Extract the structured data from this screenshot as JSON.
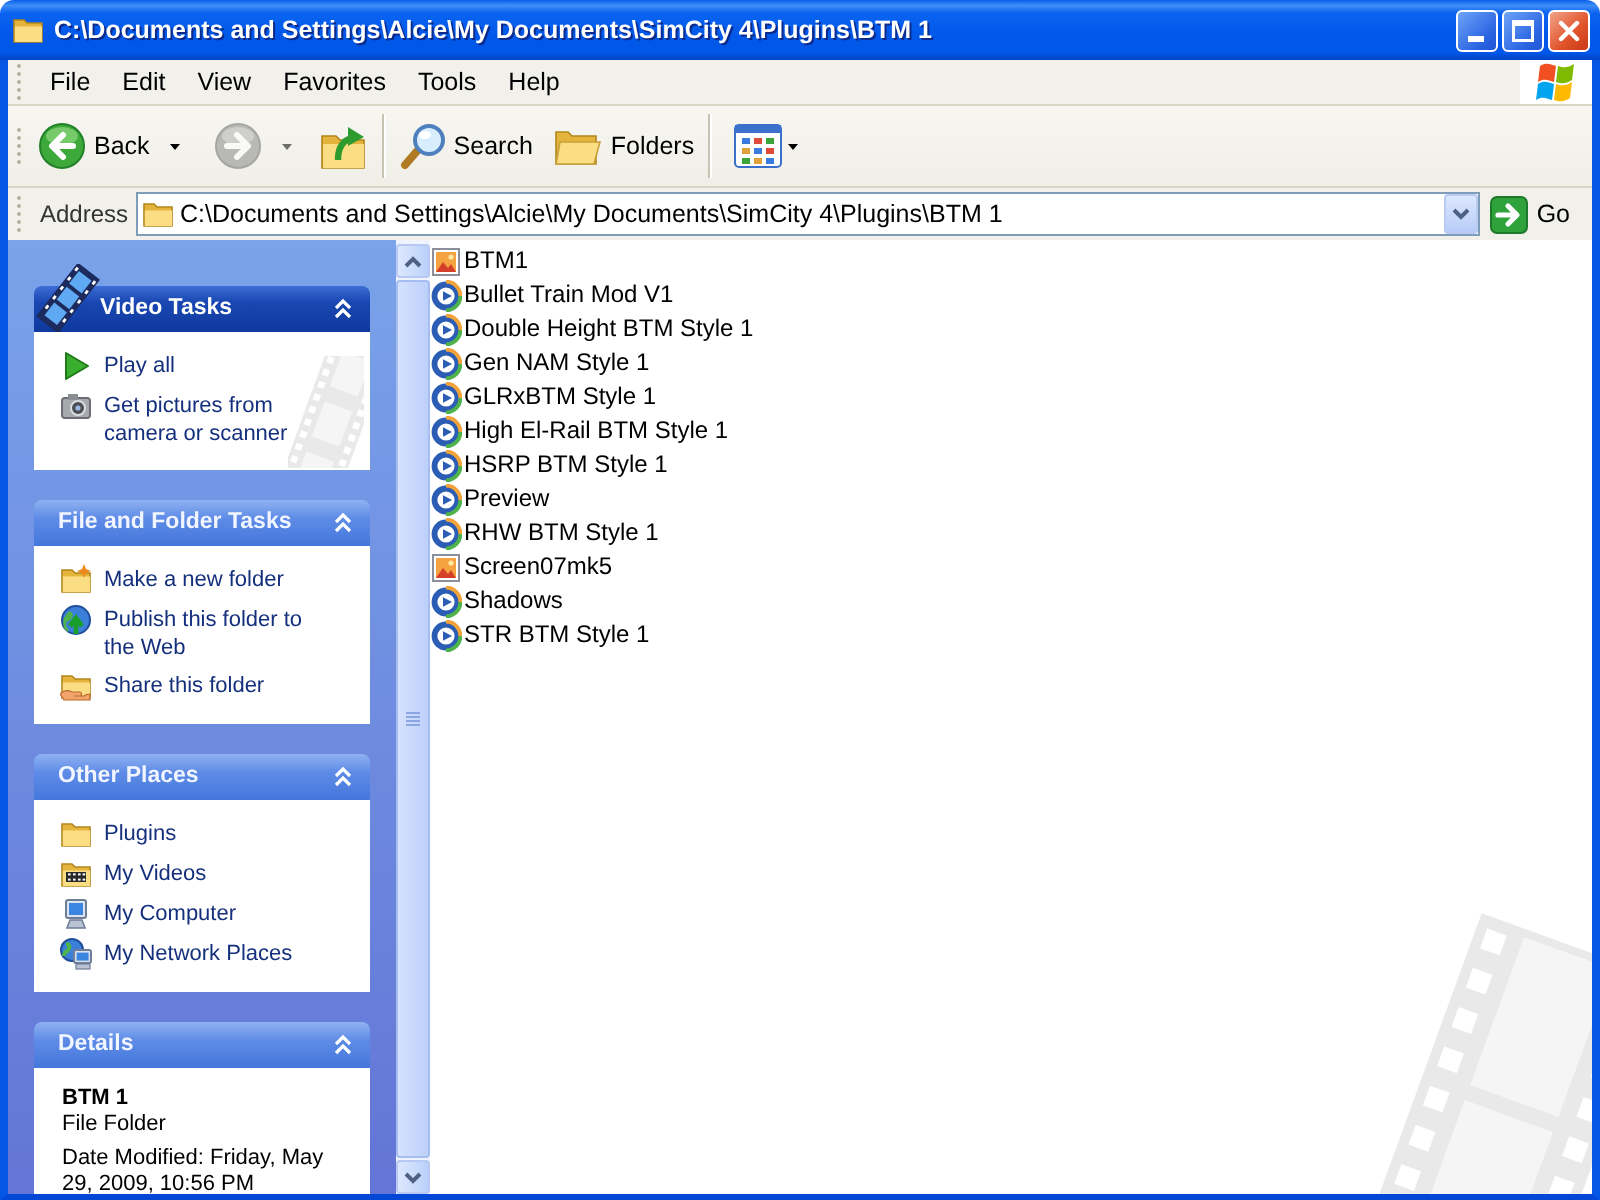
{
  "window": {
    "title": "C:\\Documents and Settings\\Alcie\\My Documents\\SimCity 4\\Plugins\\BTM 1"
  },
  "menu": [
    {
      "label": "File"
    },
    {
      "label": "Edit"
    },
    {
      "label": "View"
    },
    {
      "label": "Favorites"
    },
    {
      "label": "Tools"
    },
    {
      "label": "Help"
    }
  ],
  "toolbar": [
    {
      "kind": "back",
      "label": "Back",
      "disabled": false,
      "dropdown": true
    },
    {
      "kind": "forward",
      "disabled": true,
      "dropdown": true
    },
    {
      "kind": "up",
      "disabled": false,
      "dropdown": false
    },
    {
      "kind": "separator"
    },
    {
      "kind": "search",
      "label": "Search",
      "disabled": false,
      "dropdown": false
    },
    {
      "kind": "folders",
      "label": "Folders",
      "disabled": false,
      "dropdown": false
    },
    {
      "kind": "separator"
    },
    {
      "kind": "views",
      "disabled": false,
      "dropdown": true
    }
  ],
  "address_bar": {
    "label": "Address",
    "value": "C:\\Documents and Settings\\Alcie\\My Documents\\SimCity 4\\Plugins\\BTM 1",
    "go_label": "Go"
  },
  "task_panes": [
    {
      "kind": "special",
      "title": "Video Tasks",
      "expanded": true,
      "items": [
        {
          "kind": "play-all",
          "label": "Play all"
        },
        {
          "kind": "get-pictures",
          "label": "Get pictures from camera or scanner"
        }
      ]
    },
    {
      "kind": "normal",
      "title": "File and Folder Tasks",
      "expanded": true,
      "items": [
        {
          "kind": "new-folder",
          "label": "Make a new folder"
        },
        {
          "kind": "publish",
          "label": "Publish this folder to the Web"
        },
        {
          "kind": "share",
          "label": "Share this folder"
        }
      ]
    },
    {
      "kind": "normal",
      "title": "Other Places",
      "expanded": true,
      "items": [
        {
          "kind": "folder",
          "label": "Plugins"
        },
        {
          "kind": "videos",
          "label": "My Videos"
        },
        {
          "kind": "computer",
          "label": "My Computer"
        },
        {
          "kind": "network",
          "label": "My Network Places"
        }
      ]
    },
    {
      "kind": "details",
      "title": "Details",
      "expanded": true,
      "name": "BTM 1",
      "type": "File Folder",
      "modified": "Date Modified: Friday, May 29, 2009, 10:56 PM"
    }
  ],
  "files": [
    {
      "kind": "image",
      "name": "BTM1"
    },
    {
      "kind": "media",
      "name": "Bullet Train Mod V1"
    },
    {
      "kind": "media",
      "name": "Double Height BTM Style 1"
    },
    {
      "kind": "media",
      "name": "Gen NAM Style 1"
    },
    {
      "kind": "media",
      "name": "GLRxBTM Style 1"
    },
    {
      "kind": "media",
      "name": "High El-Rail BTM Style 1"
    },
    {
      "kind": "media",
      "name": "HSRP BTM Style 1"
    },
    {
      "kind": "media",
      "name": "Preview"
    },
    {
      "kind": "media",
      "name": "RHW BTM Style 1"
    },
    {
      "kind": "image",
      "name": "Screen07mk5"
    },
    {
      "kind": "media",
      "name": "Shadows"
    },
    {
      "kind": "media",
      "name": "STR BTM Style 1"
    }
  ]
}
